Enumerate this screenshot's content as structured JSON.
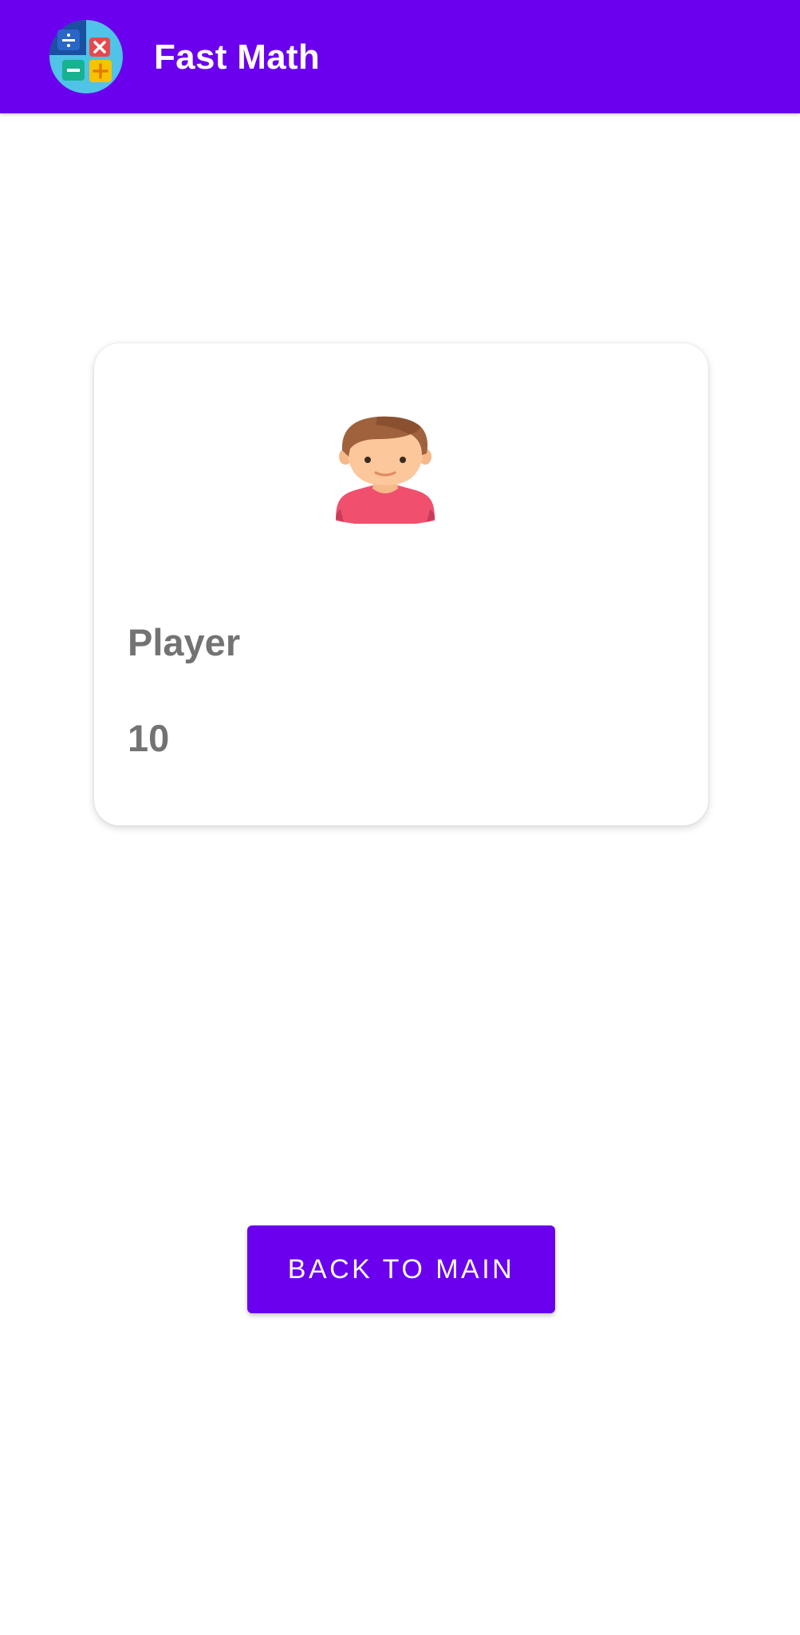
{
  "app_bar": {
    "logo_icon": "calculator-operations-icon",
    "title": "Fast Math",
    "background_color": "#6a00ee"
  },
  "player_card": {
    "avatar_icon": "boy-avatar-icon",
    "name": "Player",
    "score": "10"
  },
  "back_button": {
    "label": "BACK TO MAIN",
    "background_color": "#6a00ee"
  }
}
